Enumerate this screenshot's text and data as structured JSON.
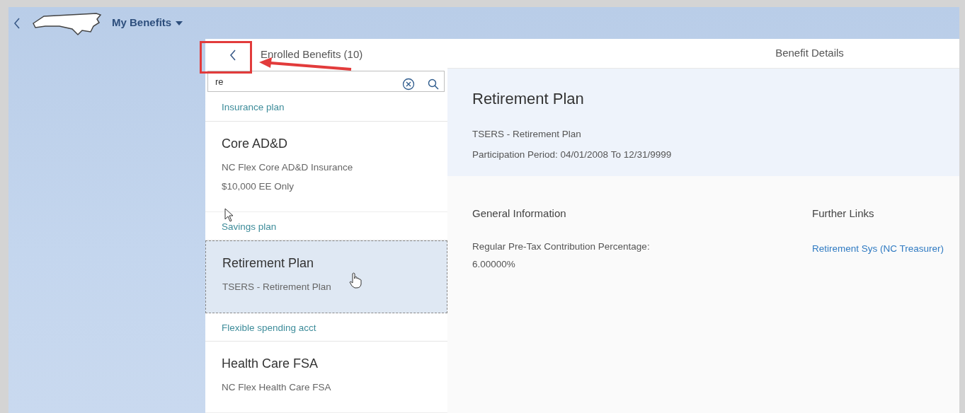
{
  "shell": {
    "title": "My Benefits"
  },
  "list": {
    "title": "Enrolled Benefits (10)",
    "search": {
      "value": "re"
    },
    "groups": [
      {
        "heading": "Insurance plan",
        "items": [
          {
            "title": "Core AD&D",
            "lines": [
              "NC Flex Core AD&D Insurance",
              "$10,000 EE Only"
            ],
            "selected": false
          }
        ]
      },
      {
        "heading": "Savings plan",
        "items": [
          {
            "title": "Retirement Plan",
            "lines": [
              "TSERS - Retirement Plan"
            ],
            "selected": true
          }
        ]
      },
      {
        "heading": "Flexible spending acct",
        "items": [
          {
            "title": "Health Care FSA",
            "lines": [
              "NC Flex Health Care FSA"
            ],
            "selected": false
          }
        ]
      }
    ]
  },
  "detail": {
    "header_title": "Benefit Details",
    "title": "Retirement Plan",
    "lines": [
      "TSERS - Retirement Plan",
      "Participation Period: 04/01/2008 To 12/31/9999"
    ],
    "general_information": {
      "heading": "General Information",
      "label": "Regular Pre-Tax Contribution Percentage:",
      "value": "6.00000%"
    },
    "further_links": {
      "heading": "Further Links",
      "links": [
        "Retirement Sys (NC Treasurer)"
      ]
    }
  }
}
